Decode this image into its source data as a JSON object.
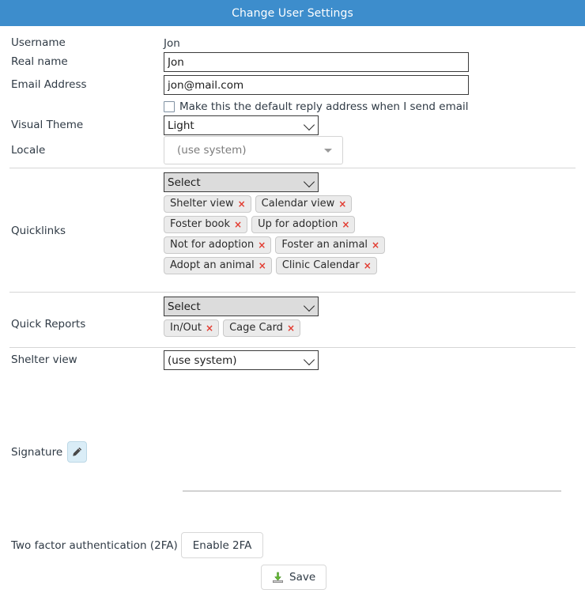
{
  "window": {
    "title": "Change User Settings",
    "header_bg": "#3d8dcc"
  },
  "fields": {
    "username": {
      "label": "Username",
      "value": "Jon"
    },
    "realname": {
      "label": "Real name",
      "value": "Jon"
    },
    "email": {
      "label": "Email Address",
      "value": "jon@mail.com",
      "default_reply_label": "Make this the default reply address when I send email",
      "default_reply_checked": false
    },
    "visual_theme": {
      "label": "Visual Theme",
      "value": "Light"
    },
    "locale": {
      "label": "Locale",
      "value": "(use system)"
    },
    "quicklinks": {
      "label": "Quicklinks",
      "select_value": "Select",
      "tags": [
        "Shelter view",
        "Calendar view",
        "Foster book",
        "Up for adoption",
        "Not for adoption",
        "Foster an animal",
        "Adopt an animal",
        "Clinic Calendar"
      ]
    },
    "quick_reports": {
      "label": "Quick Reports",
      "select_value": "Select",
      "tags": [
        "In/Out",
        "Cage Card"
      ]
    },
    "shelter_view": {
      "label": "Shelter view",
      "value": "(use system)"
    },
    "signature": {
      "label": "Signature",
      "edit_icon": "pencil-icon"
    },
    "two_factor": {
      "label": "Two factor authentication (2FA)",
      "button": "Enable 2FA"
    }
  },
  "footer": {
    "save_label": "Save",
    "save_icon": "save-download-icon"
  },
  "tag_remove_glyph": "×",
  "colors": {
    "accent": "#3d8dcc",
    "tag_bg": "#ebebeb",
    "tag_remove": "#e23b30",
    "pencil_bg": "#daedf7",
    "save_icon_green": "#66bb33"
  }
}
